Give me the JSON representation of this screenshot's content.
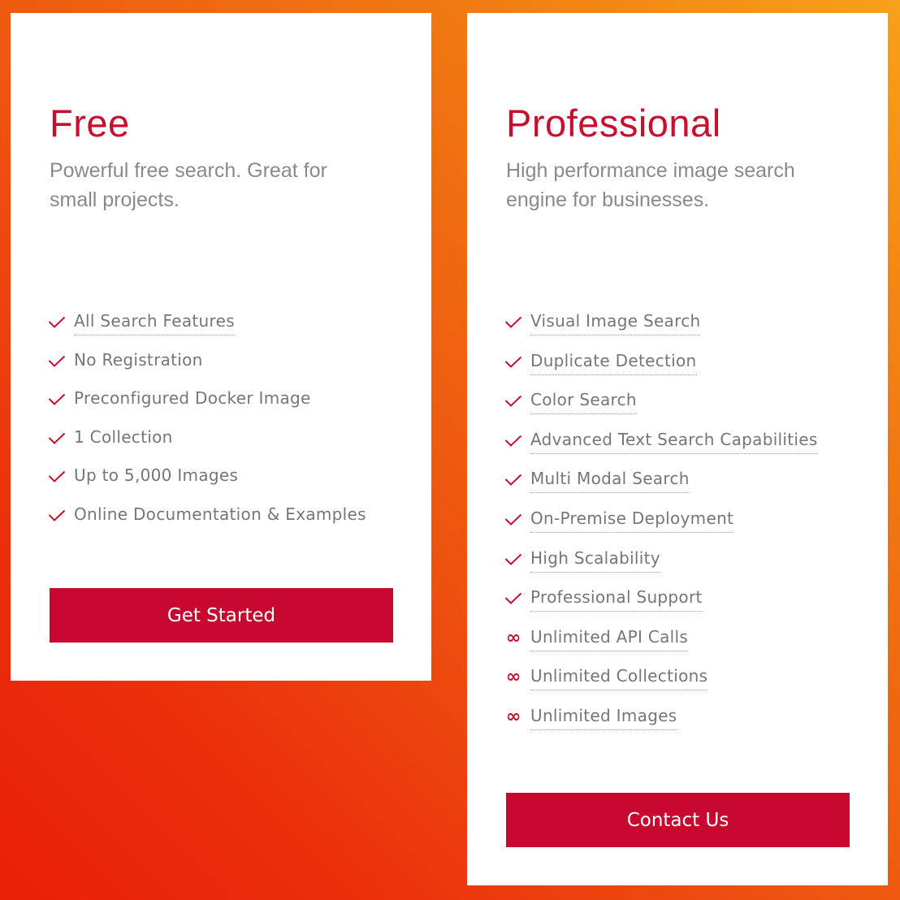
{
  "colors": {
    "accent": "#c8102e",
    "button": "#c8092f",
    "feature_text": "#767676",
    "description_text": "#8a8a8a",
    "background_gradient": [
      "#f8a11a",
      "#e91f08"
    ]
  },
  "plans": [
    {
      "name": "Free",
      "description": "Powerful free search. Great for small projects.",
      "features": [
        {
          "label": "All Search Features",
          "icon": "check-icon",
          "underlined": true
        },
        {
          "label": "No Registration",
          "icon": "check-icon",
          "underlined": false
        },
        {
          "label": "Preconfigured Docker Image",
          "icon": "check-icon",
          "underlined": false
        },
        {
          "label": "1 Collection",
          "icon": "check-icon",
          "underlined": false
        },
        {
          "label": "Up to 5,000 Images",
          "icon": "check-icon",
          "underlined": false
        },
        {
          "label": "Online Documentation & Examples",
          "icon": "check-icon",
          "underlined": false
        }
      ],
      "cta_label": "Get Started"
    },
    {
      "name": "Professional",
      "description": "High performance image search engine for businesses.",
      "features": [
        {
          "label": "Visual Image Search",
          "icon": "check-icon",
          "underlined": true
        },
        {
          "label": "Duplicate Detection",
          "icon": "check-icon",
          "underlined": true
        },
        {
          "label": "Color Search",
          "icon": "check-icon",
          "underlined": true
        },
        {
          "label": "Advanced Text Search Capabilities",
          "icon": "check-icon",
          "underlined": true
        },
        {
          "label": "Multi Modal Search",
          "icon": "check-icon",
          "underlined": true
        },
        {
          "label": "On-Premise Deployment",
          "icon": "check-icon",
          "underlined": true
        },
        {
          "label": "High Scalability",
          "icon": "check-icon",
          "underlined": true
        },
        {
          "label": "Professional Support",
          "icon": "check-icon",
          "underlined": true
        },
        {
          "label": "Unlimited API Calls",
          "icon": "infinity-icon",
          "underlined": true
        },
        {
          "label": "Unlimited Collections",
          "icon": "infinity-icon",
          "underlined": true
        },
        {
          "label": "Unlimited Images",
          "icon": "infinity-icon",
          "underlined": true
        }
      ],
      "cta_label": "Contact Us"
    }
  ]
}
